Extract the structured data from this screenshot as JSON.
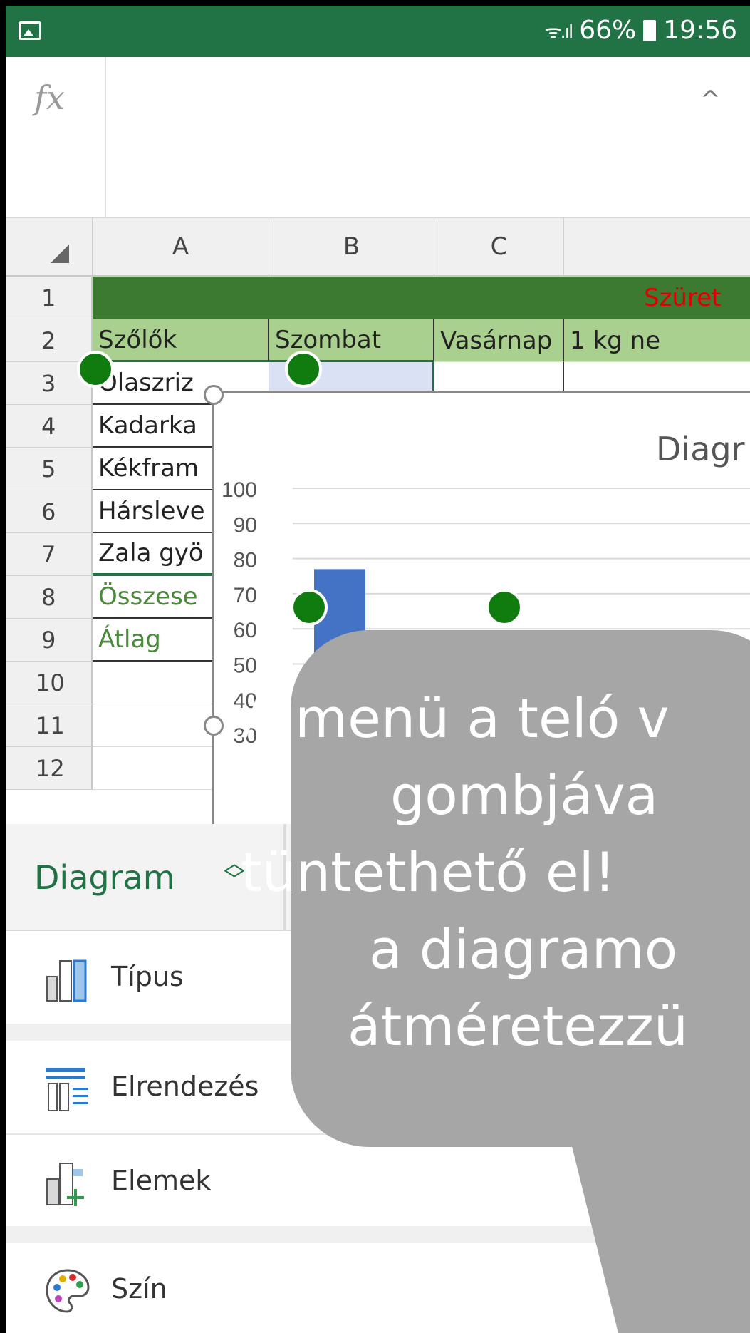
{
  "status_bar": {
    "wifi_signal": "ᯤ.ıl",
    "battery": "66%",
    "time": "19:56"
  },
  "formula_bar": {
    "fx_label": "fx",
    "collapse_icon": "^"
  },
  "columns": [
    "A",
    "B",
    "C"
  ],
  "rows": [
    "1",
    "2",
    "3",
    "4",
    "5",
    "6",
    "7",
    "8",
    "9",
    "10",
    "11",
    "12"
  ],
  "cells": {
    "r1_title": "Szüret",
    "r2_a": "Szőlők",
    "r2_b": "Szombat",
    "r2_c": "Vasárnap",
    "r2_d": "1 kg ne",
    "r3_a": "Olaszriz",
    "r4_a": "Kadarka",
    "r5_a": "Kékfram",
    "r6_a": "Hársleve",
    "r7_a": "Zala gyö",
    "r8_a": "Összese",
    "r9_a": "Átlag"
  },
  "chart_data": {
    "type": "bar",
    "title": "Diagr",
    "yticks": [
      "100",
      "90",
      "80",
      "70",
      "60",
      "50",
      "40",
      "30"
    ],
    "ylim": [
      0,
      100
    ],
    "categories": [
      ""
    ],
    "values": [
      77
    ],
    "bar_color": "#4472c4"
  },
  "menu": {
    "header_label": "Diagram",
    "header_icon": "up-down-chevron-icon",
    "items": [
      {
        "label": "Típus",
        "icon": "chart-type-icon"
      },
      {
        "label": "Elrendezés",
        "icon": "layout-icon"
      },
      {
        "label": "Elemek",
        "icon": "elements-icon"
      },
      {
        "label": "Szín",
        "icon": "palette-icon",
        "arrow": ">"
      }
    ]
  },
  "callout": {
    "lines": [
      "A menü a teló v",
      "gombjáva",
      "tüntethető el!",
      "a diagramo",
      "átméretezzü"
    ],
    "color": "#a6a6a6"
  }
}
